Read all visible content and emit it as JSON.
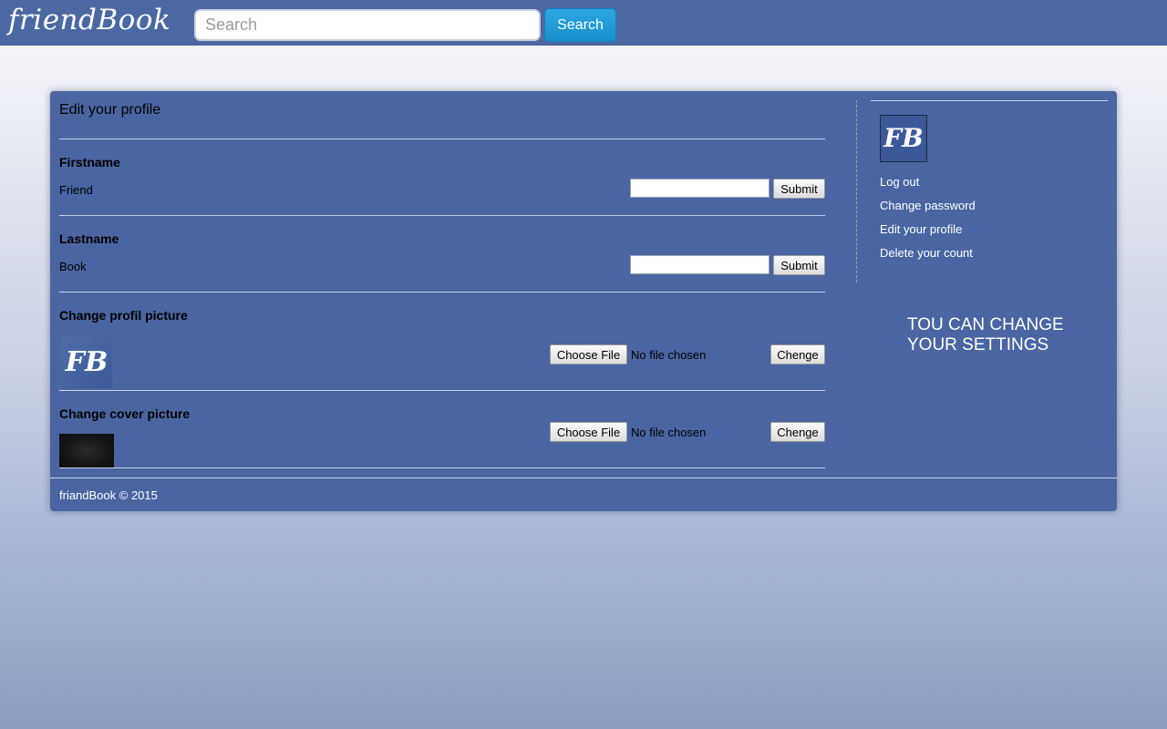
{
  "header": {
    "logo": "friendBook",
    "search_placeholder": "Search",
    "search_button": "Search"
  },
  "profile": {
    "title": "Edit your profile",
    "firstname": {
      "label": "Firstname",
      "value": "Friend",
      "submit": "Submit"
    },
    "lastname": {
      "label": "Lastname",
      "value": "Book",
      "submit": "Submit"
    },
    "profile_picture": {
      "label": "Change profil picture",
      "thumb_text": "FB",
      "choose": "Choose File",
      "status": "No file chosen",
      "action": "Chenge"
    },
    "cover_picture": {
      "label": "Change cover picture",
      "choose": "Choose File",
      "status": "No file chosen",
      "action": "Chenge"
    }
  },
  "sidebar": {
    "avatar_text": "FB",
    "links": [
      "Log out",
      "Change password",
      "Edit your profile",
      "Delete your count"
    ],
    "note_line1": "TOU CAN CHANGE",
    "note_line2": "YOUR SETTINGS"
  },
  "footer": {
    "text": "friandBook © 2015"
  },
  "colors": {
    "topbar": "#4c68a3",
    "panel": "#4a65a1",
    "search_button": "#1e98d6"
  }
}
